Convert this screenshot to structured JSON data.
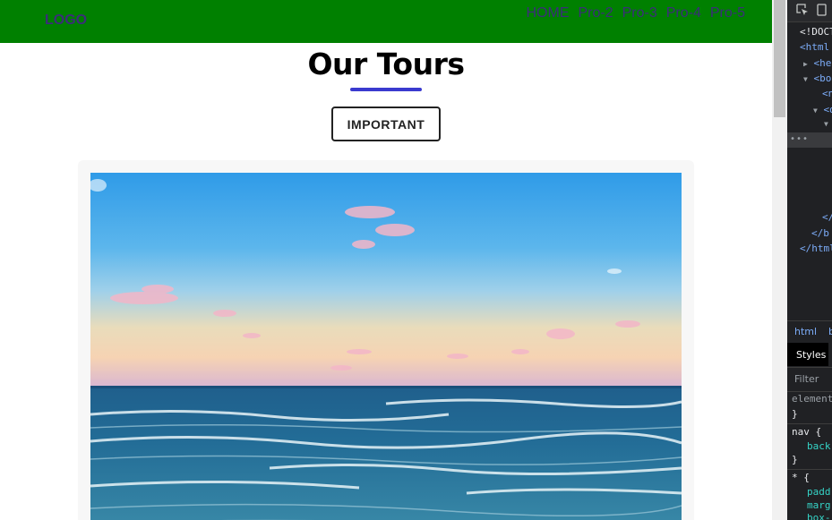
{
  "navbar": {
    "logo": "LOGO",
    "links": [
      "HOME",
      "Pro-2",
      "Pro-3",
      "Pro-4",
      "Pro-5"
    ]
  },
  "main": {
    "title": "Our Tours",
    "button_label": "IMPORTANT"
  },
  "devtools": {
    "elements": {
      "doctype": "<!DOCT",
      "html_open": "<html",
      "head": "<hea",
      "body": "<bod",
      "child1": "<n",
      "child2": "<d",
      "close1": "</",
      "close_body": "</b",
      "close_html": "</html"
    },
    "breadcrumb": [
      "html",
      "b"
    ],
    "tab_styles": "Styles",
    "filter_placeholder": "Filter",
    "rules": {
      "element_selector": "element",
      "brace_close": "}",
      "nav_selector": "nav {",
      "nav_prop": "back",
      "star_selector": "* {",
      "star_prop1": "padd",
      "star_prop2": "marg",
      "star_prop3": "box-"
    }
  },
  "colors": {
    "navbar_bg": "#008000",
    "nav_text": "#3b2d7a",
    "underline": "#3a3acf"
  }
}
